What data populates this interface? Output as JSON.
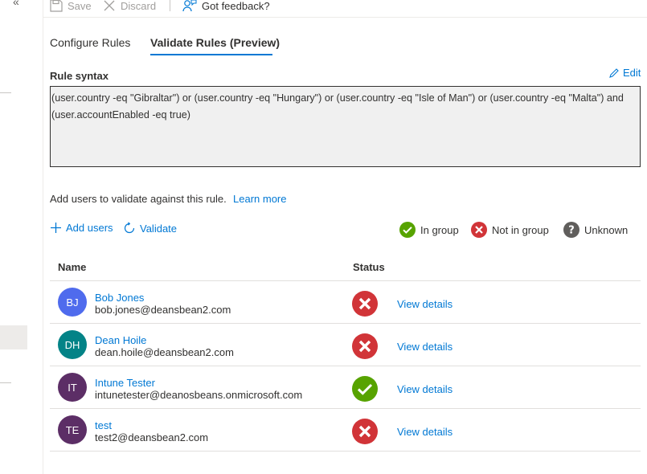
{
  "toolbar": {
    "save_label": "Save",
    "discard_label": "Discard",
    "feedback_label": "Got feedback?"
  },
  "tabs": [
    {
      "label": "Configure Rules",
      "active": false
    },
    {
      "label": "Validate Rules (Preview)",
      "active": true
    }
  ],
  "rule": {
    "label": "Rule syntax",
    "edit_label": "Edit",
    "syntax": "(user.country -eq \"Gibraltar\") or (user.country -eq \"Hungary\") or (user.country -eq \"Isle of Man\") or (user.country -eq \"Malta\") and (user.accountEnabled -eq true)"
  },
  "validate": {
    "info_text": "Add users to validate against this rule.",
    "learn_more": "Learn more",
    "add_users": "Add users",
    "validate_label": "Validate"
  },
  "legend": {
    "in_group": "In group",
    "not_in_group": "Not in group",
    "unknown": "Unknown"
  },
  "colors": {
    "accent": "#0078d4",
    "in_group": "#57a300",
    "not_in_group": "#d13438",
    "unknown": "#605e5c"
  },
  "table": {
    "headers": {
      "name": "Name",
      "status": "Status"
    },
    "view_details": "View details",
    "rows": [
      {
        "initials": "BJ",
        "name": "Bob Jones",
        "email": "bob.jones@deansbean2.com",
        "status": "not-in-group",
        "avatar_color": "#4f6bed"
      },
      {
        "initials": "DH",
        "name": "Dean Hoile",
        "email": "dean.hoile@deansbean2.com",
        "status": "not-in-group",
        "avatar_color": "#038387"
      },
      {
        "initials": "IT",
        "name": "Intune Tester",
        "email": "intunetester@deanosbeans.onmicrosoft.com",
        "status": "in-group",
        "avatar_color": "#5c2e66"
      },
      {
        "initials": "TE",
        "name": "test",
        "email": "test2@deansbean2.com",
        "status": "not-in-group",
        "avatar_color": "#5c2e66"
      }
    ]
  }
}
